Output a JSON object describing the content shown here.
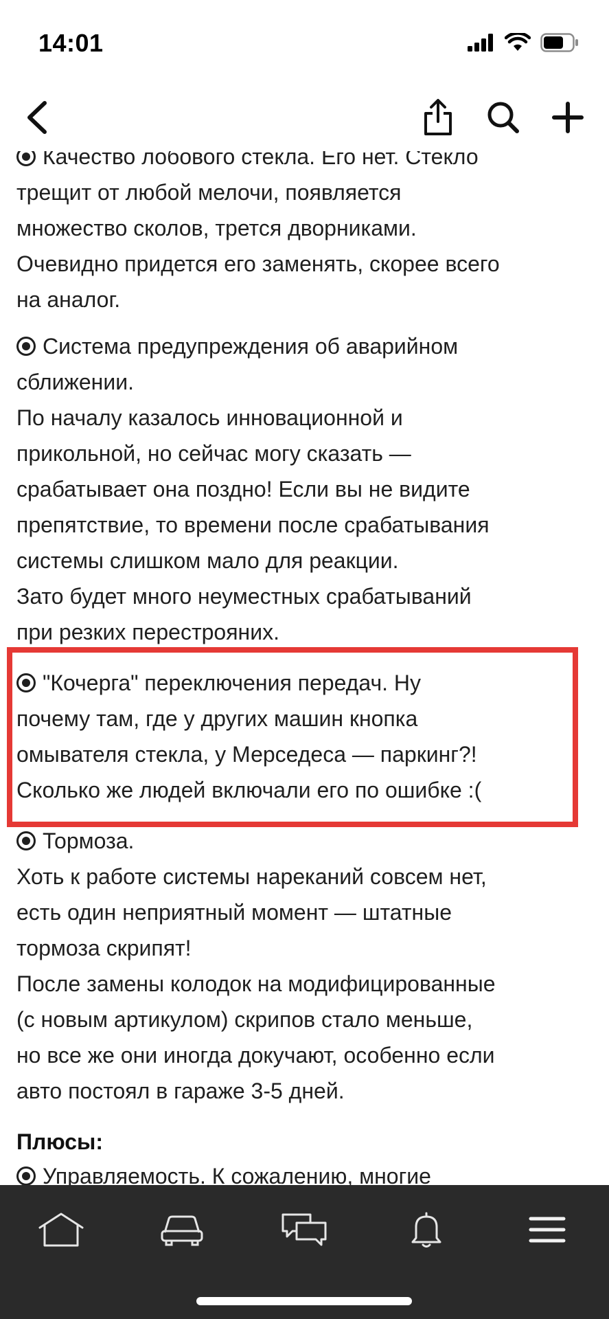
{
  "status_bar": {
    "time": "14:01"
  },
  "article": {
    "paragraphs": [
      {
        "bullet": true,
        "lines": [
          "Качество лобового стекла. Его нет. Стекло",
          "трещит от любой мелочи, появляется",
          "множество сколов, трется дворниками.",
          "Очевидно придется его заменять, скорее всего",
          "на аналог."
        ]
      },
      {
        "bullet": true,
        "lines": [
          "Система предупреждения об аварийном",
          "сближении.",
          "По началу казалось инновационной и",
          "прикольной, но сейчас могу сказать —",
          "срабатывает она поздно! Если вы не видите",
          "препятствие, то времени после срабатывания",
          "системы слишком мало для реакции.",
          "Зато будет много неуместных срабатываний",
          "при резких перестрояних."
        ]
      },
      {
        "bullet": true,
        "lines": [
          "\"Кочерга\" переключения передач. Ну",
          "почему там, где у других машин кнопка",
          "омывателя стекла, у Мерседеса — паркинг?!",
          "Сколько же людей включали его по ошибке :("
        ]
      },
      {
        "bullet": true,
        "lines": [
          "Тормоза.",
          "Хоть к работе системы нареканий совсем нет,",
          "есть один неприятный момент — штатные",
          "тормоза скрипят!",
          "После замены колодок на модифицированные",
          "(с новым артикулом) скрипов стало меньше,",
          "но все же они иногда докучают, особенно если",
          "авто постоял в гараже 3-5 дней."
        ]
      }
    ],
    "pros_title": "Плюсы:",
    "pros_first_line": "Управляемость. К сожалению, многие"
  },
  "icons": {
    "back": "chevron-left-icon",
    "share": "share-icon",
    "search": "search-icon",
    "add": "plus-icon"
  },
  "tab_bar": {
    "items": [
      {
        "icon": "home-icon"
      },
      {
        "icon": "car-icon"
      },
      {
        "icon": "chat-icon"
      },
      {
        "icon": "bell-icon"
      },
      {
        "icon": "menu-icon"
      }
    ]
  },
  "colors": {
    "highlight": "#e53935",
    "tab_bar_bg": "#2a2a2a",
    "text": "#1f1f1f"
  }
}
